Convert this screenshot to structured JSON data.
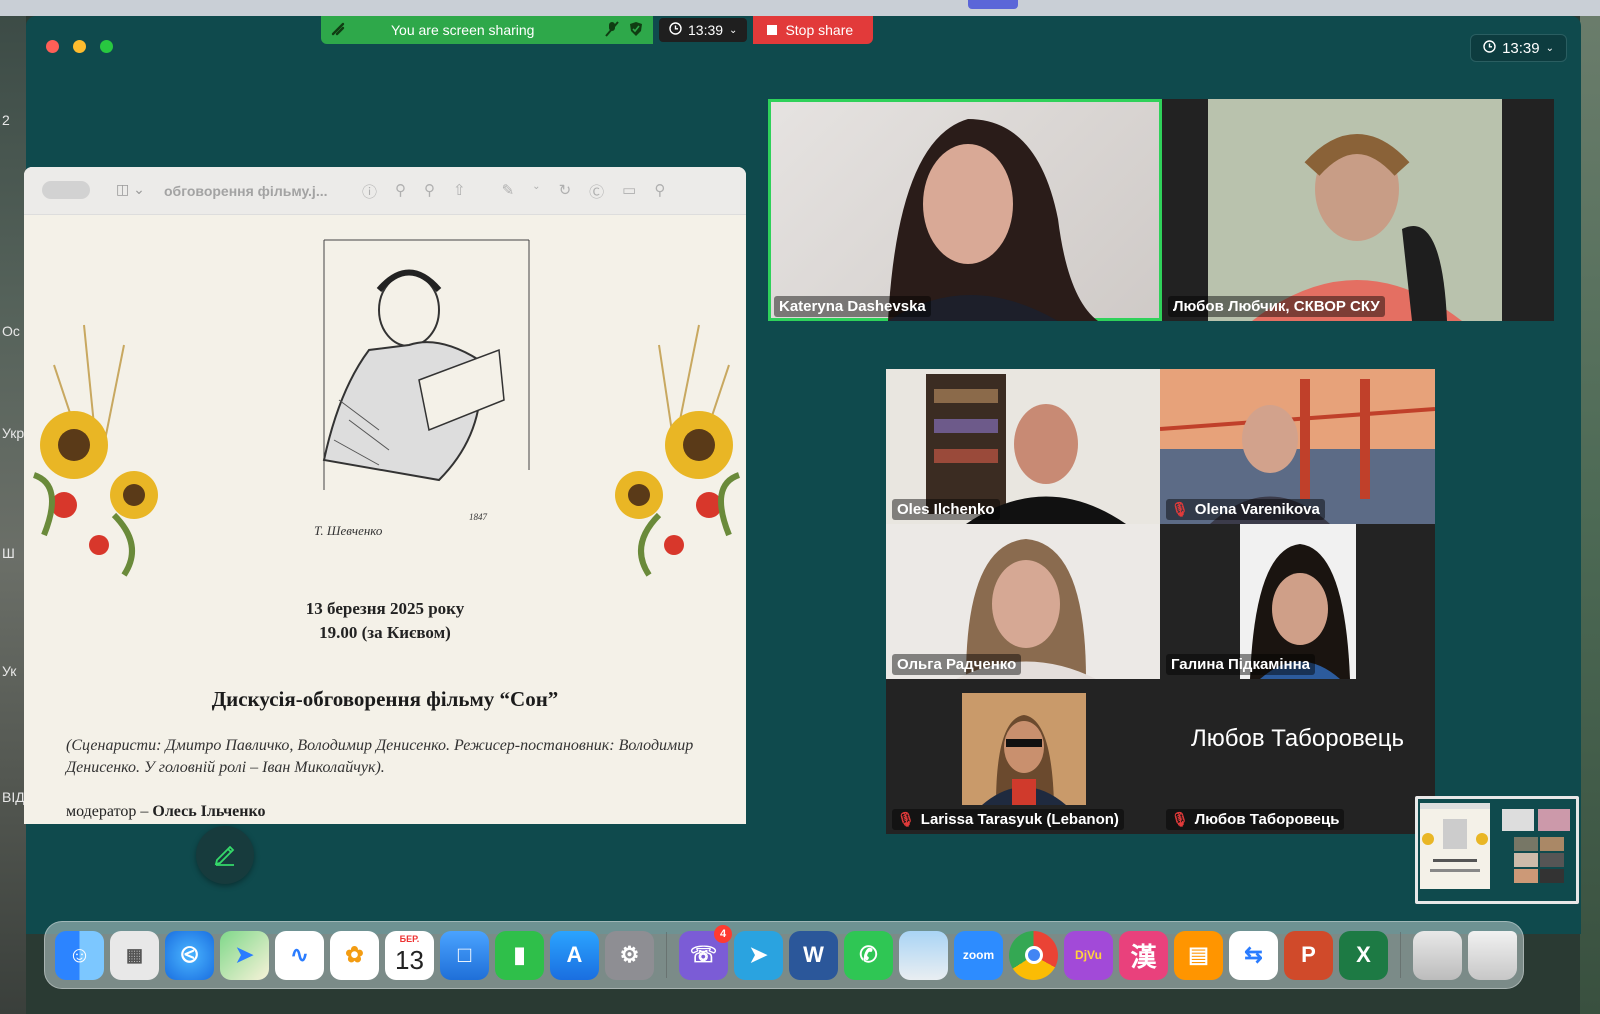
{
  "desktop": {
    "left_fragments": [
      "2",
      "Ос",
      "Укр",
      "Ш",
      "Ук",
      "ВІД"
    ]
  },
  "share_bar": {
    "status": "You are screen sharing",
    "time": "13:39",
    "stop_label": "Stop share"
  },
  "corner_time": "13:39",
  "preview": {
    "file_title": "обговорення фільму.j...",
    "signature": "Т. Шевченко",
    "year_mark": "1847",
    "date_line1": "13 березня 2025 року",
    "date_line2": "19.00 (за Києвом)",
    "heading": "Дискусія-обговорення фільму “Сон”",
    "credits": "(Сценаристи: Дмитро Павличко, Володимир Денисенко. Режисер-постановник: Володимир Денисенко. У головній ролі – Іван Миколайчук).",
    "moderator_prefix": "модератор – ",
    "moderator_name": "Олесь Ільченко"
  },
  "participants": {
    "p1": "Kateryna Dashevska",
    "p2": "Любов Любчик, СКВОР СКУ",
    "p3": "Oles Ilchenko",
    "p4": "Olena Varenikova",
    "p5": "Ольга Радченко",
    "p6": "Галина Підкамінна",
    "p7": "Larissa Tarasyuk (Lebanon)",
    "p8_big": "Любов Таборовець",
    "p8": "Любов Таборовець"
  },
  "dock": {
    "calendar_month": "БЕР.",
    "calendar_day": "13",
    "viber_badge": "4",
    "zoom_label": "zoom",
    "word_label": "W",
    "ppt_label": "P",
    "excel_label": "X",
    "djvu_label": "DjVu",
    "han_label": "漢",
    "icons": [
      "finder-icon",
      "launchpad-icon",
      "safari-icon",
      "maps-icon",
      "freeform-icon",
      "photos-icon",
      "calendar-icon",
      "keynote-icon",
      "numbers-icon",
      "app-store-icon",
      "system-settings-icon",
      "viber-icon",
      "telegram-icon",
      "word-icon",
      "whatsapp-icon",
      "preview-icon",
      "zoom-icon",
      "chrome-icon",
      "djvu-icon",
      "dictionary-icon",
      "books-icon",
      "remote-icon",
      "powerpoint-icon",
      "excel-icon",
      "document-stack-icon",
      "trash-icon"
    ]
  },
  "colors": {
    "zoom_bg": "#0f4a4d",
    "share_green": "#2ea84a",
    "stop_red": "#e23a3a",
    "speaker_outline": "#2fd15a"
  }
}
